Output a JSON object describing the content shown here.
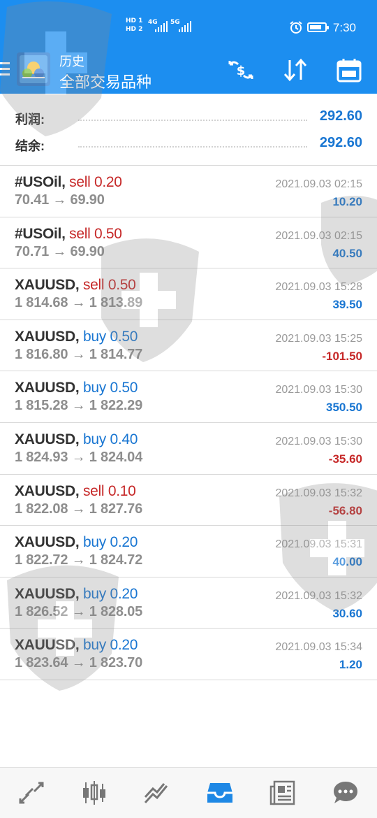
{
  "status_bar": {
    "sim1": "HD 1",
    "sim2": "HD 2",
    "net1": "4G",
    "net2": "5G",
    "time": "7:30",
    "battery_level": 0.8
  },
  "header": {
    "title": "历史",
    "subtitle": "全部交易品种",
    "icons": [
      "menu-icon",
      "app-logo",
      "exchange-icon",
      "sort-icon",
      "calendar-icon"
    ]
  },
  "summary": {
    "profit_label": "利润:",
    "profit_value": "292.60",
    "balance_label": "结余:",
    "balance_value": "292.60"
  },
  "trades": [
    {
      "symbol": "#USOil",
      "action": "sell",
      "volume": "0.20",
      "prices": "70.41 → 69.90",
      "time": "2021.09.03 02:15",
      "profit": "10.20",
      "sign": "pos"
    },
    {
      "symbol": "#USOil",
      "action": "sell",
      "volume": "0.50",
      "prices": "70.71 → 69.90",
      "time": "2021.09.03 02:15",
      "profit": "40.50",
      "sign": "pos"
    },
    {
      "symbol": "XAUUSD",
      "action": "sell",
      "volume": "0.50",
      "prices": "1 814.68 → 1 813.89",
      "time": "2021.09.03 15:28",
      "profit": "39.50",
      "sign": "pos"
    },
    {
      "symbol": "XAUUSD",
      "action": "buy",
      "volume": "0.50",
      "prices": "1 816.80 → 1 814.77",
      "time": "2021.09.03 15:25",
      "profit": "-101.50",
      "sign": "neg"
    },
    {
      "symbol": "XAUUSD",
      "action": "buy",
      "volume": "0.50",
      "prices": "1 815.28 → 1 822.29",
      "time": "2021.09.03 15:30",
      "profit": "350.50",
      "sign": "pos"
    },
    {
      "symbol": "XAUUSD",
      "action": "buy",
      "volume": "0.40",
      "prices": "1 824.93 → 1 824.04",
      "time": "2021.09.03 15:30",
      "profit": "-35.60",
      "sign": "neg"
    },
    {
      "symbol": "XAUUSD",
      "action": "sell",
      "volume": "0.10",
      "prices": "1 822.08 → 1 827.76",
      "time": "2021.09.03 15:32",
      "profit": "-56.80",
      "sign": "neg"
    },
    {
      "symbol": "XAUUSD",
      "action": "buy",
      "volume": "0.20",
      "prices": "1 822.72 → 1 824.72",
      "time": "2021.09.03 15:31",
      "profit": "40.00",
      "sign": "pos"
    },
    {
      "symbol": "XAUUSD",
      "action": "buy",
      "volume": "0.20",
      "prices": "1 826.52 → 1 828.05",
      "time": "2021.09.03 15:32",
      "profit": "30.60",
      "sign": "pos"
    },
    {
      "symbol": "XAUUSD",
      "action": "buy",
      "volume": "0.20",
      "prices": "1 823.64 → 1 823.70",
      "time": "2021.09.03 15:34",
      "profit": "1.20",
      "sign": "pos"
    }
  ],
  "bottom_nav": {
    "items": [
      "quotes-icon",
      "chart-icon",
      "trade-icon",
      "history-icon",
      "news-icon",
      "chat-icon"
    ],
    "active_index": 3
  },
  "colors": {
    "header_bg": "#1c8ef0",
    "positive": "#1976d2",
    "negative": "#c62828",
    "active_nav": "#1e88e5"
  }
}
